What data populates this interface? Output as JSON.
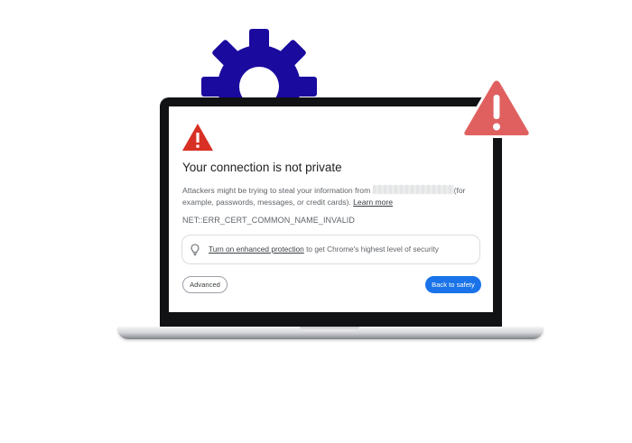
{
  "interstitial": {
    "title": "Your connection is not private",
    "description_prefix": "Attackers might be trying to steal your information from",
    "description_suffix": "(for example, passwords, messages, or credit cards).",
    "learn_more": "Learn more",
    "error_code": "NET::ERR_CERT_COMMON_NAME_INVALID",
    "enhanced_link": "Turn on enhanced protection",
    "enhanced_rest": "to get Chrome's highest level of security",
    "advanced_button": "Advanced",
    "back_button": "Back to safety"
  },
  "icons": {
    "warning": "warning-triangle-icon",
    "bulb": "lightbulb-icon",
    "gear": "gear-icon",
    "overlay_warning": "warning-triangle-icon"
  },
  "colors": {
    "warning_red": "#d93025",
    "overlay_red": "#e06060",
    "gear_blue": "#1a0a9e",
    "button_blue": "#1a73e8"
  }
}
